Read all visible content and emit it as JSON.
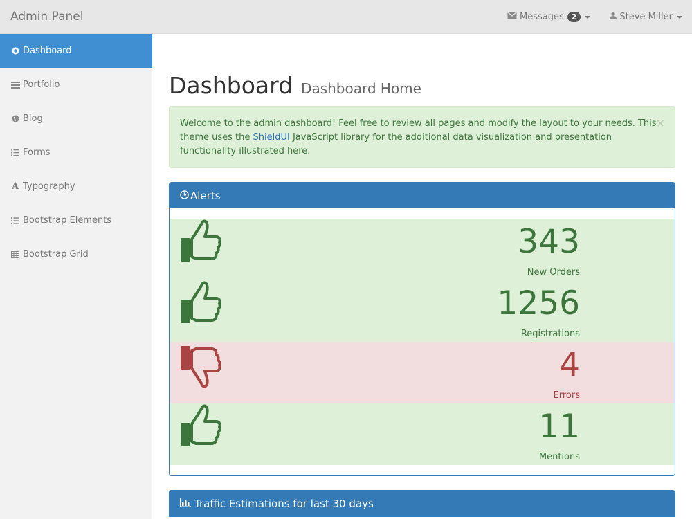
{
  "brand": "Admin Panel",
  "navbar": {
    "messages_label": "Messages",
    "messages_count": "2",
    "user_name": "Steve Miller"
  },
  "sidebar": {
    "items": [
      {
        "label": "Dashboard",
        "icon": "dashboard-icon",
        "active": true
      },
      {
        "label": "Portfolio",
        "icon": "table-icon"
      },
      {
        "label": "Blog",
        "icon": "globe-icon"
      },
      {
        "label": "Forms",
        "icon": "list-ol-icon"
      },
      {
        "label": "Typography",
        "icon": "font-icon"
      },
      {
        "label": "Bootstrap Elements",
        "icon": "list-icon"
      },
      {
        "label": "Bootstrap Grid",
        "icon": "grid-icon"
      }
    ]
  },
  "page": {
    "title": "Dashboard",
    "subtitle": "Dashboard Home"
  },
  "alert": {
    "text_before": "Welcome to the admin dashboard! Feel free to review all pages and modify the layout to your needs. This theme uses the ",
    "link_text": "ShieldUI",
    "text_after": " JavaScript library for the additional data visualization and presentation functionality illustrated here.",
    "close": "×"
  },
  "alerts_panel": {
    "title": "Alerts",
    "stats": [
      {
        "value": "343",
        "label": "New Orders",
        "status": "good"
      },
      {
        "value": "1256",
        "label": "Registrations",
        "status": "good"
      },
      {
        "value": "4",
        "label": "Errors",
        "status": "bad"
      },
      {
        "value": "11",
        "label": "Mentions",
        "status": "good"
      }
    ]
  },
  "traffic_panel": {
    "title": "Traffic Estimations for last 30 days"
  },
  "colors": {
    "primary": "#337ab7",
    "sidebar_active": "#3f8fd2",
    "success_bg": "#dff0d8",
    "success_text": "#3c763d",
    "danger_bg": "#f2dede",
    "danger_text": "#a94442"
  }
}
